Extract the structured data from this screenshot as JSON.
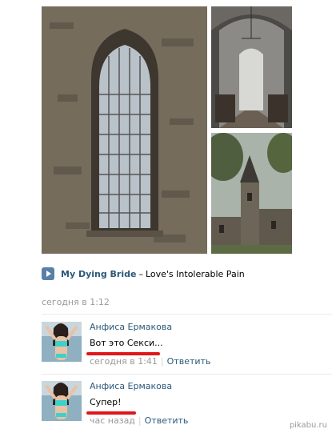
{
  "audio": {
    "artist": "My Dying Bride",
    "separator": "–",
    "track": "Love's Intolerable Pain"
  },
  "post": {
    "date": "сегодня в 1:12"
  },
  "comments": [
    {
      "author": "Анфиса Ермакова",
      "text": "Вот это Секси...",
      "time": "сегодня в 1:41",
      "separator": "|",
      "reply": "Ответить"
    },
    {
      "author": "Анфиса Ермакова",
      "text": "Супер!",
      "time": "час назад",
      "separator": "|",
      "reply": "Ответить"
    }
  ],
  "watermark": "pikabu.ru",
  "colors": {
    "link": "#2b587a",
    "meta": "#999999",
    "play_button": "#5b7fa6",
    "highlight": "#e0161a"
  }
}
